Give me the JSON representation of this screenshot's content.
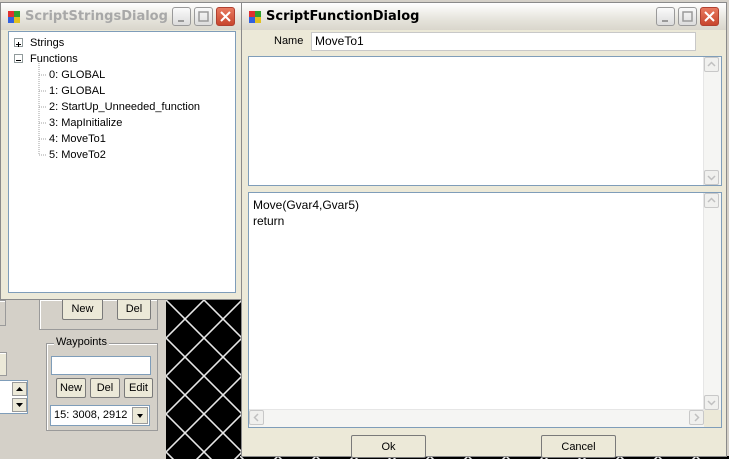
{
  "background_app": {
    "buttons": {
      "new_label": "New",
      "del_label": "Del"
    },
    "waypoints": {
      "group_label": "Waypoints",
      "input_value": "",
      "new_label": "New",
      "del_label": "Del",
      "edit_label": "Edit",
      "selected_waypoint": "15:  3008, 2912"
    }
  },
  "strings_dialog": {
    "title": "ScriptStringsDialog",
    "tree": {
      "strings_label": "Strings",
      "functions_label": "Functions",
      "functions": [
        "0: GLOBAL",
        "1: GLOBAL",
        "2: StartUp_Unneeded_function",
        "3: MapInitialize",
        "4: MoveTo1",
        "5: MoveTo2"
      ]
    }
  },
  "function_dialog": {
    "title": "ScriptFunctionDialog",
    "name_label": "Name",
    "name_value": "MoveTo1",
    "code_lines": [
      "Move(Gvar4,Gvar5)",
      "return"
    ],
    "ok_label": "Ok",
    "cancel_label": "Cancel"
  }
}
